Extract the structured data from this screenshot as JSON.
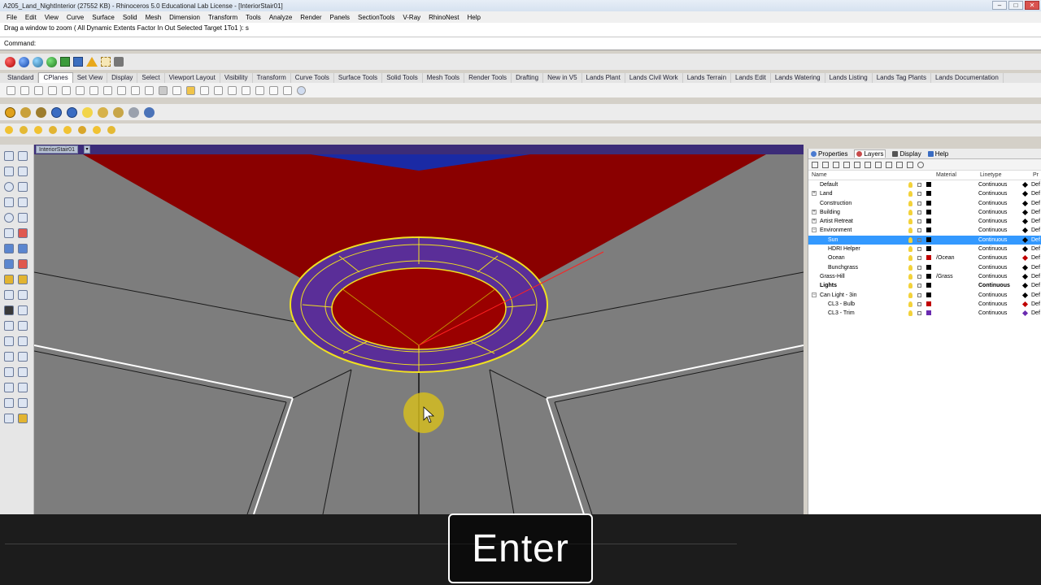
{
  "app": {
    "title": "A205_Land_NightInterior (27552 KB) - Rhinoceros 5.0 Educational Lab License - [InteriorStair01]",
    "win_min": "–",
    "win_max": "□",
    "win_close": "✕"
  },
  "menu": [
    "File",
    "Edit",
    "View",
    "Curve",
    "Surface",
    "Solid",
    "Mesh",
    "Dimension",
    "Transform",
    "Tools",
    "Analyze",
    "Render",
    "Panels",
    "SectionTools",
    "V-Ray",
    "RhinoNest",
    "Help"
  ],
  "command": {
    "history": "Drag a window to zoom ( All  Dynamic  Extents  Factor  In  Out  Selected  Target  1To1 ): s",
    "prompt_label": "Command:",
    "value": ""
  },
  "toolbar_tabs": [
    "Standard",
    "CPlanes",
    "Set View",
    "Display",
    "Select",
    "Viewport Layout",
    "Visibility",
    "Transform",
    "Curve Tools",
    "Surface Tools",
    "Solid Tools",
    "Mesh Tools",
    "Render Tools",
    "Drafting",
    "New in V5",
    "Lands Plant",
    "Lands Civil Work",
    "Lands Terrain",
    "Lands Edit",
    "Lands Watering",
    "Lands Listing",
    "Lands Tag Plants",
    "Lands Documentation"
  ],
  "active_tab": "CPlanes",
  "viewport": {
    "name": "InteriorStair01",
    "dropdown": "▾"
  },
  "panel": {
    "tabs": [
      "Properties",
      "Layers",
      "Display",
      "Help"
    ],
    "active_tab": "Layers",
    "columns": {
      "name": "Name",
      "material": "Material",
      "linetype": "Linetype",
      "print": "Pr"
    },
    "layers": [
      {
        "name": "Default",
        "indent": 1,
        "expand": "",
        "color": "#000000",
        "material": "",
        "linetype": "Continuous",
        "print": "Def",
        "selected": false,
        "current": false,
        "bold": false
      },
      {
        "name": "Land",
        "indent": 1,
        "expand": "+",
        "color": "#000000",
        "material": "",
        "linetype": "Continuous",
        "print": "Def",
        "selected": false,
        "current": false,
        "bold": false
      },
      {
        "name": "Construction",
        "indent": 1,
        "expand": "",
        "color": "#000000",
        "material": "",
        "linetype": "Continuous",
        "print": "Def",
        "selected": false,
        "current": false,
        "bold": false
      },
      {
        "name": "Building",
        "indent": 1,
        "expand": "+",
        "color": "#000000",
        "material": "",
        "linetype": "Continuous",
        "print": "Def",
        "selected": false,
        "current": false,
        "bold": false
      },
      {
        "name": "Artist Retreat",
        "indent": 1,
        "expand": "+",
        "color": "#000000",
        "material": "",
        "linetype": "Continuous",
        "print": "Def",
        "selected": false,
        "current": false,
        "bold": false
      },
      {
        "name": "Environment",
        "indent": 1,
        "expand": "−",
        "color": "#000000",
        "material": "",
        "linetype": "Continuous",
        "print": "Def",
        "selected": false,
        "current": false,
        "bold": false
      },
      {
        "name": "Sun",
        "indent": 2,
        "expand": "",
        "color": "#000000",
        "material": "",
        "linetype": "Continuous",
        "print": "Def",
        "selected": true,
        "current": false,
        "bold": false
      },
      {
        "name": "HDRI Helper",
        "indent": 2,
        "expand": "",
        "color": "#000000",
        "material": "",
        "linetype": "Continuous",
        "print": "Def",
        "selected": false,
        "current": false,
        "bold": false
      },
      {
        "name": "Ocean",
        "indent": 2,
        "expand": "",
        "color": "#c00000",
        "material": "/Ocean",
        "linetype": "Continuous",
        "print": "Def",
        "selected": false,
        "current": false,
        "bold": false
      },
      {
        "name": "Bunchgrass",
        "indent": 2,
        "expand": "",
        "color": "#000000",
        "material": "",
        "linetype": "Continuous",
        "print": "Def",
        "selected": false,
        "current": false,
        "bold": false
      },
      {
        "name": "Grass-Hill",
        "indent": 1,
        "expand": "",
        "color": "#000000",
        "material": "/Grass",
        "linetype": "Continuous",
        "print": "Def",
        "selected": false,
        "current": false,
        "bold": false
      },
      {
        "name": "Lights",
        "indent": 1,
        "expand": "",
        "color": "#000000",
        "material": "",
        "linetype": "Continuous",
        "print": "Def",
        "selected": false,
        "current": true,
        "bold": true
      },
      {
        "name": "Can Light - 3in",
        "indent": 1,
        "expand": "−",
        "color": "#000000",
        "material": "",
        "linetype": "Continuous",
        "print": "Def",
        "selected": false,
        "current": false,
        "bold": false
      },
      {
        "name": "CL3 - Bulb",
        "indent": 2,
        "expand": "",
        "color": "#c00000",
        "material": "",
        "linetype": "Continuous",
        "print": "Def",
        "selected": false,
        "current": false,
        "bold": false
      },
      {
        "name": "CL3 - Trim",
        "indent": 2,
        "expand": "",
        "color": "#6a2bb0",
        "material": "",
        "linetype": "Continuous",
        "print": "Def",
        "selected": false,
        "current": false,
        "bold": false
      }
    ]
  },
  "caption": "Enter"
}
